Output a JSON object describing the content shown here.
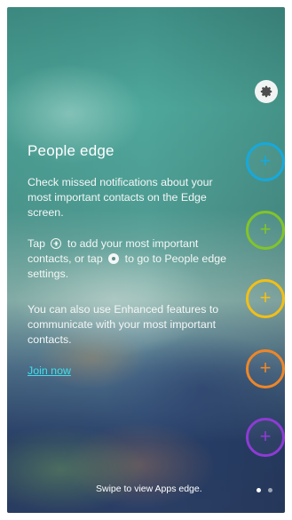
{
  "panel": {
    "title": "People edge",
    "paragraph1": "Check missed notifications about your most important contacts on the Edge screen.",
    "paragraph2": {
      "part1": "Tap",
      "part2": "to add your most important contacts, or tap",
      "part3": "to go to People edge settings.",
      "add_icon": "add-circle-icon",
      "settings_icon": "settings-icon"
    },
    "paragraph3": "You can also use Enhanced features to communicate with your most important contacts.",
    "join_link": "Join now",
    "link_color": "#3fe0ee"
  },
  "settings_button": {
    "icon": "gear-icon"
  },
  "contact_slots": [
    {
      "symbol": "+",
      "color": "#17a9dc"
    },
    {
      "symbol": "+",
      "color": "#82c429"
    },
    {
      "symbol": "+",
      "color": "#f2bf16"
    },
    {
      "symbol": "+",
      "color": "#ef8628"
    },
    {
      "symbol": "+",
      "color": "#8e3bd4"
    }
  ],
  "footer": {
    "swipe_hint": "Swipe to view Apps edge.",
    "pages": 2,
    "active_page": 1
  }
}
